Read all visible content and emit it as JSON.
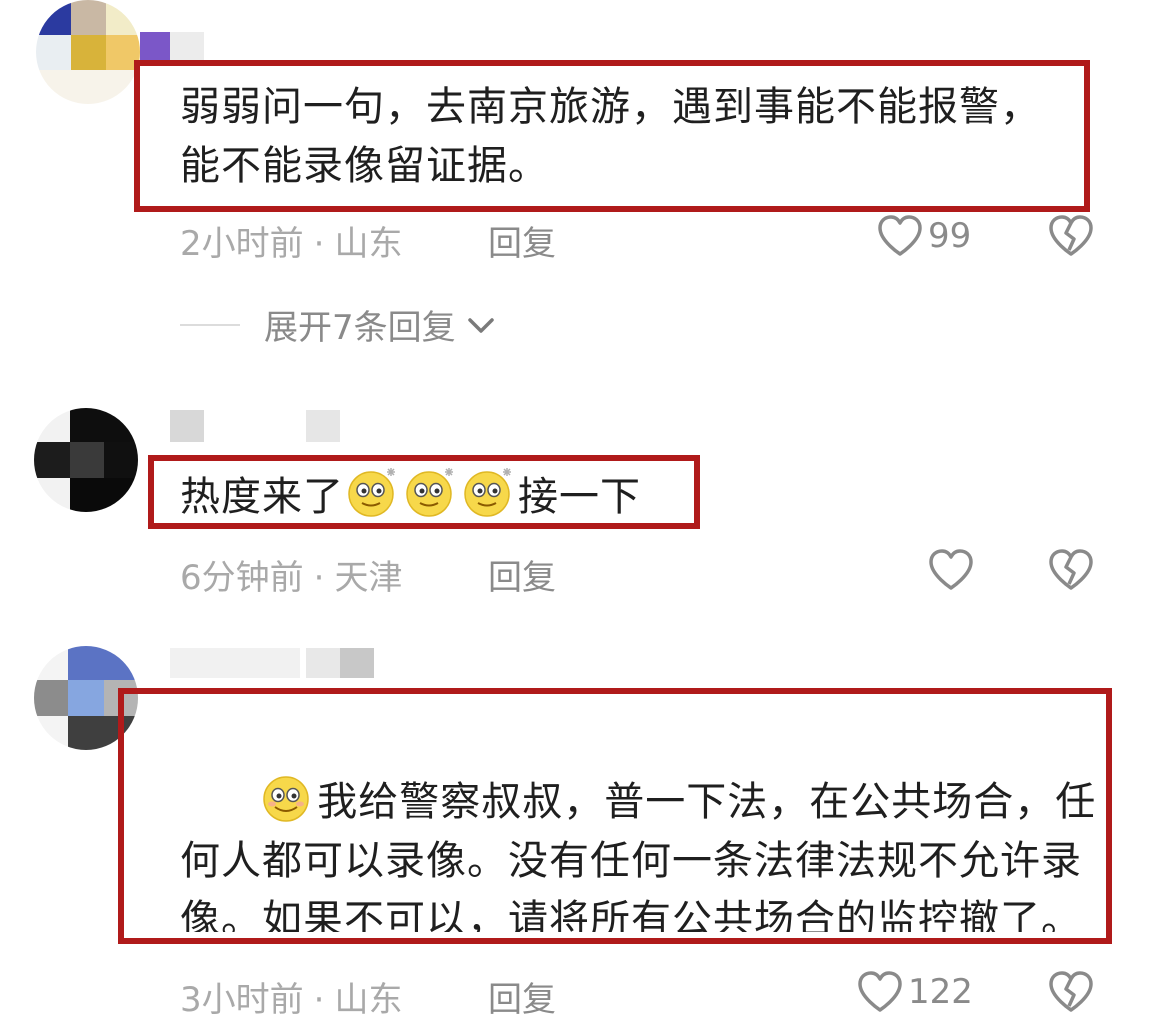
{
  "comments": [
    {
      "text": "弱弱问一句，去南京旅游，遇到事能不能报警，能不能录像留证据。",
      "time": "2小时前",
      "location": "山东",
      "reply_label": "回复",
      "likes": "99",
      "expand_label": "展开7条回复"
    },
    {
      "text_before": "热度来了",
      "text_after": "接一下",
      "time": "6分钟前",
      "location": "天津",
      "reply_label": "回复",
      "likes": ""
    },
    {
      "text": "我给警察叔叔，普一下法，在公共场合，任何人都可以录像。没有任何一条法律法规不允许录像。如果不可以，请将所有公共场合的监控撤了。",
      "time": "3小时前",
      "location": "山东",
      "reply_label": "回复",
      "likes": "122"
    }
  ],
  "separator": "·",
  "icons": {
    "like": "heart-outline-icon",
    "dislike": "broken-heart-icon",
    "expand": "chevron-down-icon",
    "emoji": "smiley-emoji-icon"
  },
  "colors": {
    "highlight_box": "#b01a1a",
    "meta_text": "#a9a9a9",
    "icon": "#8a8a8a"
  }
}
